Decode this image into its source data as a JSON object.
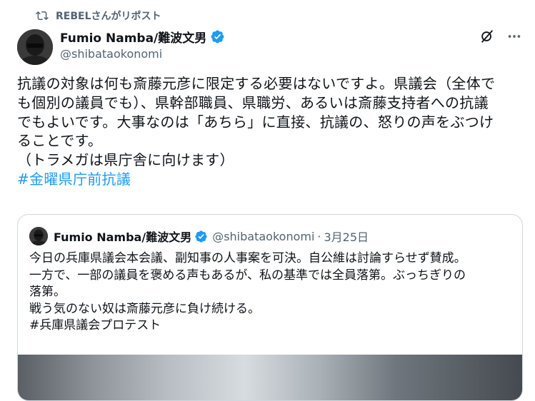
{
  "repost": {
    "text": "REBELさんがリポスト",
    "icon": "repost-icon"
  },
  "tweet": {
    "author_name": "Fumio Namba/難波文男",
    "handle": "@shibataokonomi",
    "body_lines": [
      "抗議の対象は何も斎藤元彦に限定する必要はないですよ。県議会（全体で",
      "も個別の議員でも）、県幹部職員、県職労、あるいは斎藤支持者への抗議",
      "でもよいです。大事なのは「あちら」に直接、抗議の、怒りの声をぶつけ",
      "ることです。",
      "（トラメガは県庁舎に向けます）"
    ],
    "hashtag": "#金曜県庁前抗議"
  },
  "quote": {
    "author_name": "Fumio Namba/難波文男",
    "handle": "@shibataokonomi",
    "dot": "·",
    "date": "3月25日",
    "body_lines": [
      "今日の兵庫県議会本会議、副知事の人事案を可決。自公維は討論すらせず賛成。",
      "一方で、一部の議員を褒める声もあるが、私の基準では全員落第。ぶっちぎりの",
      "落第。",
      "戦う気のない奴は斎藤元彦に負け続ける。",
      "#兵庫県議会プロテスト"
    ]
  },
  "colors": {
    "accent": "#1d9bf0",
    "muted": "#536471",
    "text": "#0f1419"
  }
}
